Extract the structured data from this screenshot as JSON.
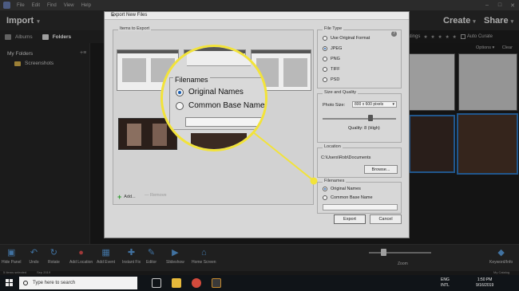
{
  "menubar": {
    "items": [
      "File",
      "Edit",
      "Find",
      "View",
      "Help"
    ],
    "controls": [
      "–",
      "□",
      "✕"
    ]
  },
  "toolbar": {
    "import": "Import",
    "create": "Create",
    "share": "Share"
  },
  "tabs": {
    "albums": "Albums",
    "folders": "Folders"
  },
  "left_panel": {
    "my_folders": "My Folders",
    "add": "+≡",
    "folder": "Screenshots"
  },
  "right_header": {
    "ratings": "Ratings",
    "stars": "★ ★ ★ ★ ★",
    "auto_curate": "Auto Curate",
    "options": "Options ▾",
    "clear": "Clear"
  },
  "dialog": {
    "title": "Export New Files",
    "close": "✕",
    "items_group": "Items to Export",
    "add": "Add...",
    "remove": "Remove",
    "file_type": {
      "label": "File Type",
      "options": [
        "Use Original Format",
        "JPEG",
        "PNG",
        "TIFF",
        "PSD"
      ],
      "selected": "JPEG",
      "help": "?"
    },
    "size_quality": {
      "label": "Size and Quality",
      "photo_size_label": "Photo Size:",
      "photo_size_value": "800 x 600 pixels",
      "quality_text": "Quality: 8 (High)",
      "quality_level": 8
    },
    "location": {
      "label": "Location",
      "path": "C:\\Users\\Rob\\Documents",
      "browse": "Browse..."
    },
    "filenames": {
      "label": "Filenames",
      "options": [
        "Original Names",
        "Common Base Name"
      ],
      "selected": "Original Names",
      "base_name": ""
    },
    "export": "Export",
    "cancel": "Cancel"
  },
  "magnifier": {
    "title": "Filenames",
    "option1": "Original Names",
    "option2": "Common Base Name"
  },
  "bottom_toolbar": {
    "items": [
      "Hide Panel",
      "Undo",
      "Rotate",
      "Add Location",
      "Add Event",
      "Instant Fix",
      "Editor",
      "Slideshow",
      "Home Screen"
    ],
    "zoom": "Zoom",
    "keyword_info": "Keyword/Info"
  },
  "status": {
    "left": "5 Items selected",
    "date": "Sep 2019",
    "catalog": "My Catalog"
  },
  "taskbar": {
    "search_placeholder": "Type here to search",
    "lang": "ENG\nINTL",
    "time": "1:50 PM",
    "date": "9/16/2019"
  },
  "colors": {
    "highlight": "#f2e33a",
    "accent": "#5a9fe0"
  }
}
